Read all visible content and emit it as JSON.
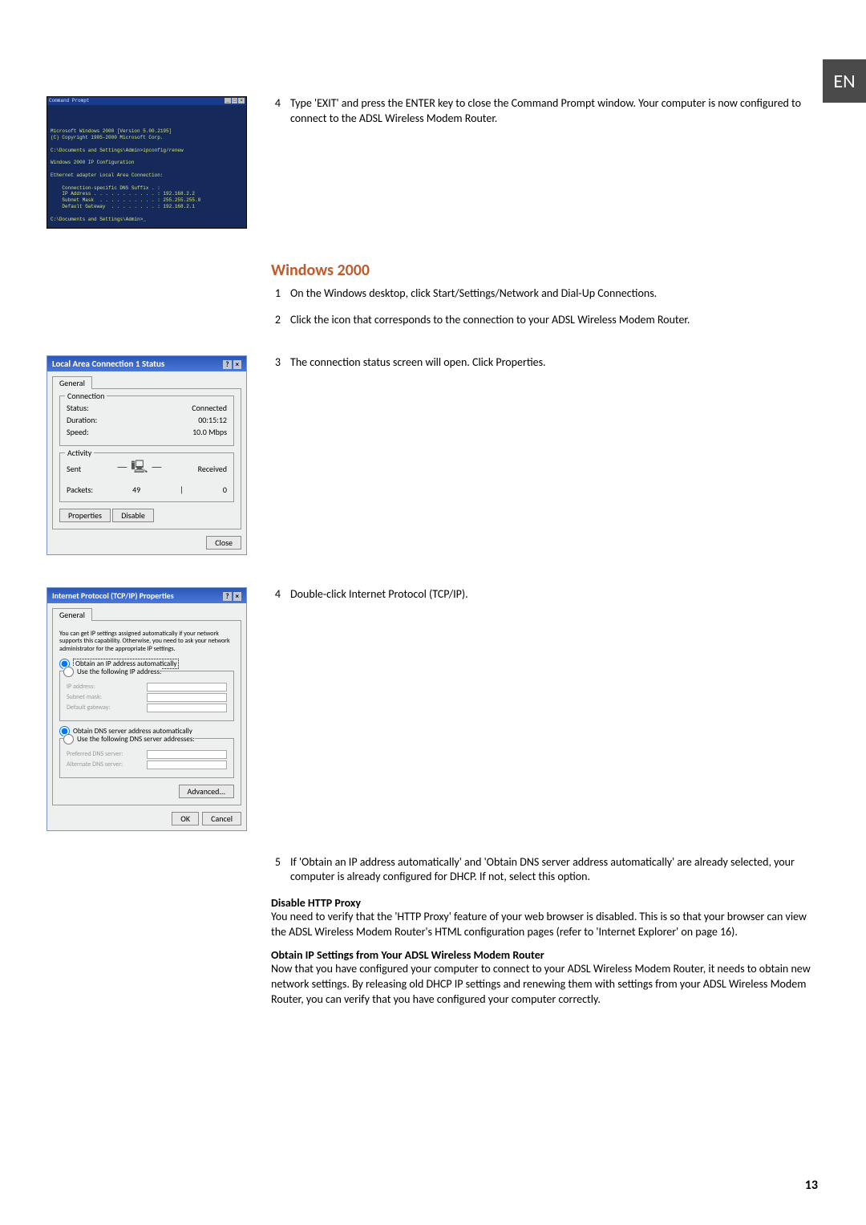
{
  "lang_badge": "EN",
  "page_number": "13",
  "step4_top": {
    "n": "4",
    "text": "Type 'EXIT' and press the ENTER key to close the Command Prompt window. Your computer is now configured to connect to the ADSL Wireless Modem Router."
  },
  "section_heading": "Windows 2000",
  "steps": [
    {
      "n": "1",
      "text": "On the Windows desktop, click Start/Settings/Network and Dial-Up Connections."
    },
    {
      "n": "2",
      "text": "Click the icon that corresponds to the connection to your ADSL Wireless Modem Router."
    },
    {
      "n": "3",
      "text": "The connection status screen will open. Click Properties."
    }
  ],
  "step4_mid": {
    "n": "4",
    "text": "Double-click Internet Protocol (TCP/IP)."
  },
  "step5": {
    "n": "5",
    "text": "If 'Obtain an IP address automatically' and 'Obtain DNS server address automatically' are already selected, your computer is already configured for DHCP. If not, select this option."
  },
  "subhead1": "Disable HTTP Proxy",
  "para1": "You need to verify that the 'HTTP Proxy' feature of your web browser is disabled. This is so that your browser can view the ADSL Wireless Modem Router's HTML configuration pages (refer to 'Internet Explorer' on page 16).",
  "subhead2": "Obtain IP Settings from Your ADSL Wireless Modem Router",
  "para2": "Now that you have configured your computer to connect to your ADSL Wireless Modem Router, it needs to obtain new network settings. By releasing old DHCP IP settings and renewing them with settings from your ADSL Wireless Modem Router, you can verify that you have configured your computer correctly.",
  "cmd": {
    "title": "Command Prompt",
    "lines": "Microsoft Windows 2000 [Version 5.00.2195]\n(C) Copyright 1985-2000 Microsoft Corp.\n\nC:\\Documents and Settings\\Admin>ipconfig/renew\n\nWindows 2000 IP Configuration\n\nEthernet adapter Local Area Connection:\n\n    Connection-specific DNS Suffix . :\n    IP Address . . . . . . . . . . . : 192.168.2.2\n    Subnet Mask  . . . . . . . . . . : 255.255.255.0\n    Default Gateway  . . . . . . . . : 192.168.2.1\n\nC:\\Documents and Settings\\Admin>_"
  },
  "status": {
    "title": "Local Area Connection 1 Status",
    "tab": "General",
    "connection_legend": "Connection",
    "status_label": "Status:",
    "status_value": "Connected",
    "duration_label": "Duration:",
    "duration_value": "00:15:12",
    "speed_label": "Speed:",
    "speed_value": "10.0 Mbps",
    "activity_legend": "Activity",
    "sent_label": "Sent",
    "received_label": "Received",
    "packets_label": "Packets:",
    "packets_sent": "49",
    "packets_recv": "0",
    "btn_properties": "Properties",
    "btn_disable": "Disable",
    "btn_close": "Close"
  },
  "tcp": {
    "title": "Internet Protocol (TCP/IP) Properties",
    "tab": "General",
    "desc": "You can get IP settings assigned automatically if your network supports this capability. Otherwise, you need to ask your network administrator for the appropriate IP settings.",
    "radio_auto_ip": "Obtain an IP address automatically",
    "radio_manual_ip": "Use the following IP address:",
    "ip_label": "IP address:",
    "subnet_label": "Subnet mask:",
    "gateway_label": "Default gateway:",
    "radio_auto_dns": "Obtain DNS server address automatically",
    "radio_manual_dns": "Use the following DNS server addresses:",
    "pref_dns_label": "Preferred DNS server:",
    "alt_dns_label": "Alternate DNS server:",
    "btn_advanced": "Advanced...",
    "btn_ok": "OK",
    "btn_cancel": "Cancel"
  }
}
